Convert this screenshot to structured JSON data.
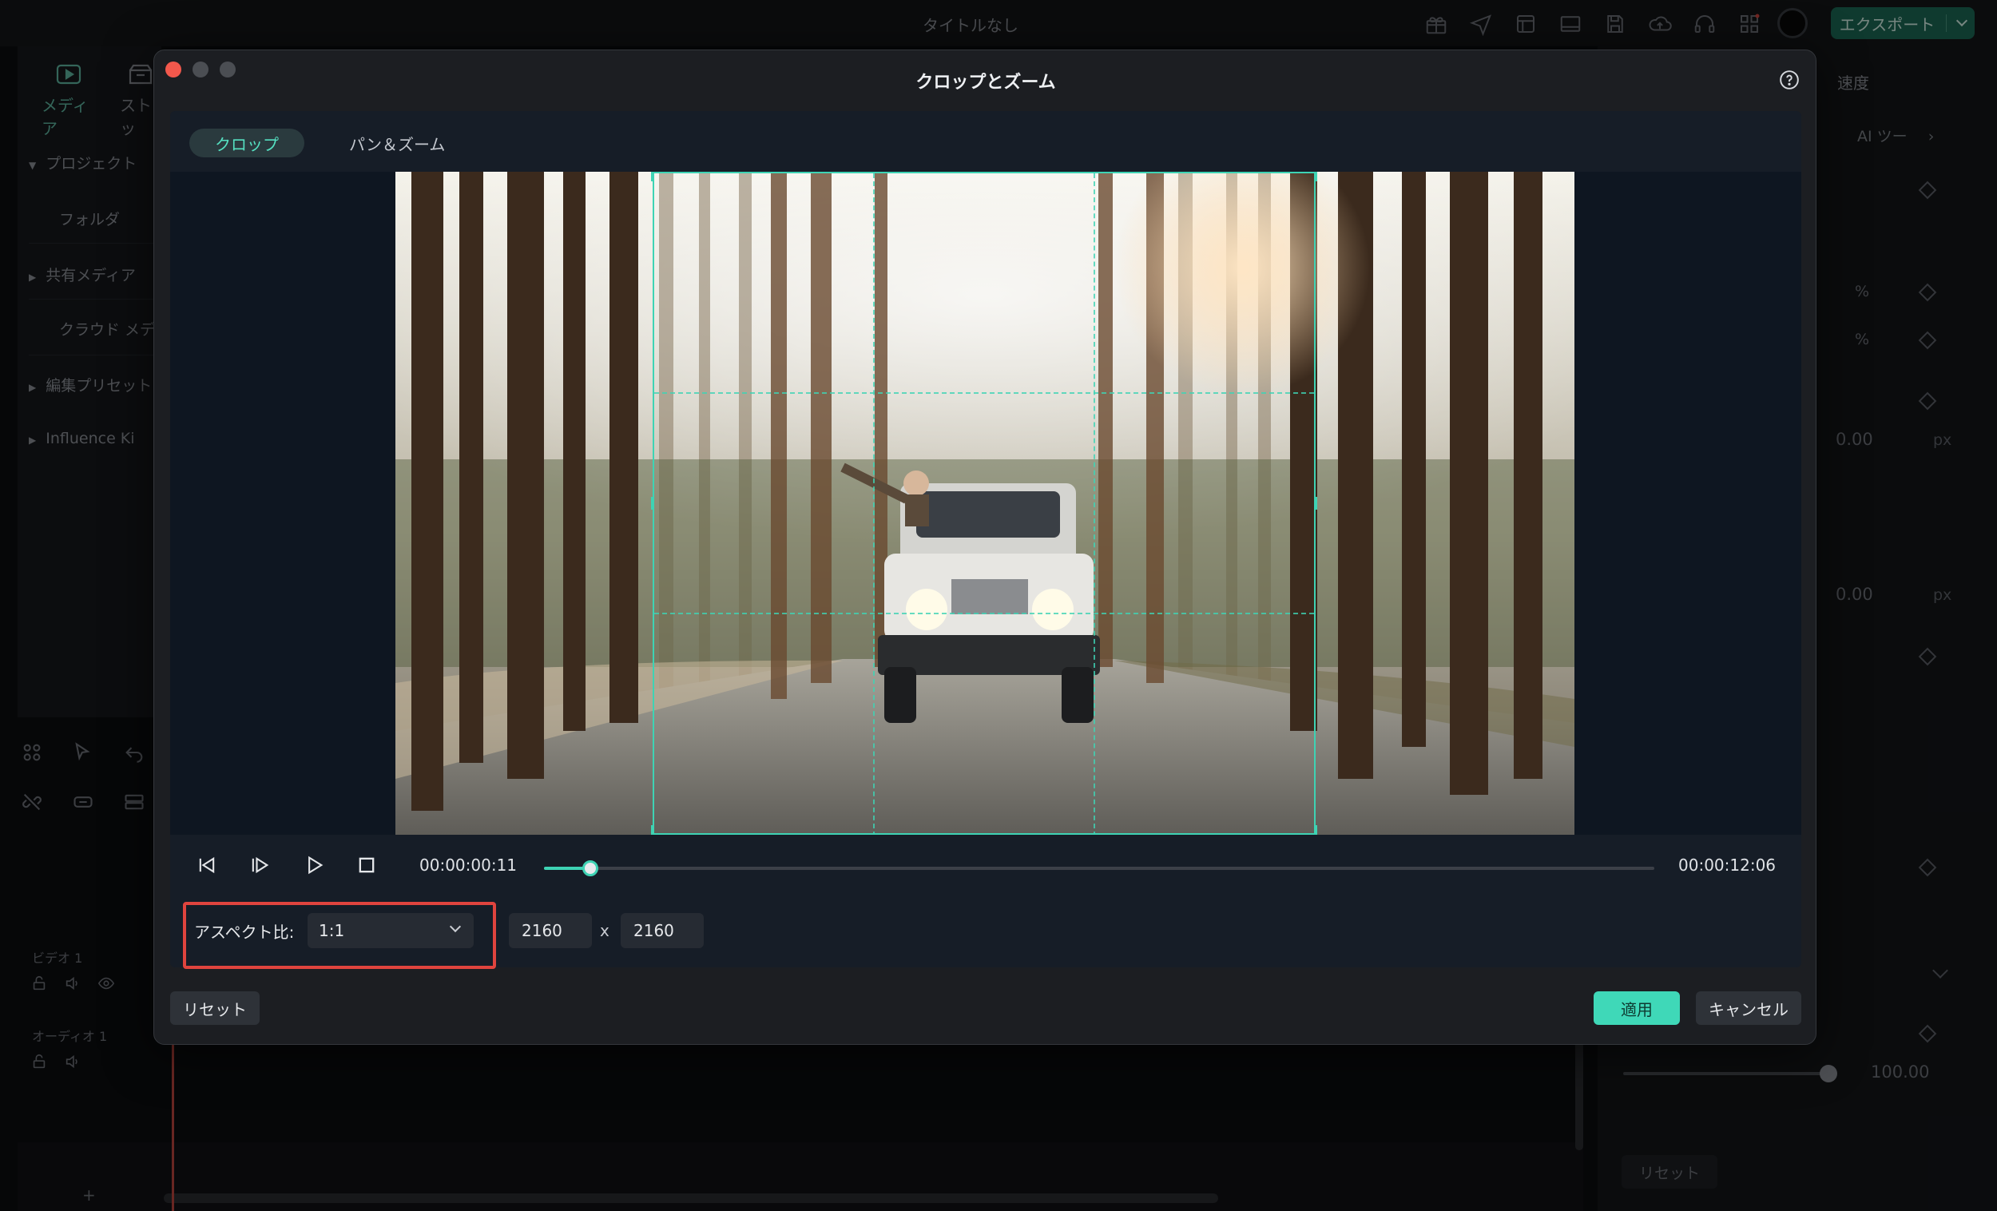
{
  "app": {
    "title": "タイトルなし",
    "export_label": "エクスポート",
    "accent": "#3ed3b4"
  },
  "left_panel": {
    "tabs": [
      {
        "label": "メディア",
        "icon": "media-icon"
      },
      {
        "label": "ストッ",
        "icon": "stock-icon"
      }
    ],
    "items": [
      {
        "label": "プロジェクト"
      },
      {
        "label": "フォルダ"
      },
      {
        "label": "共有メディア"
      },
      {
        "label": "クラウド メデ"
      },
      {
        "label": "編集プリセット"
      },
      {
        "label": "Influence Ki"
      }
    ]
  },
  "timeline": {
    "video_track": "ビデオ 1",
    "audio_track": "オーディオ 1"
  },
  "right_panel": {
    "speed_tab": "速度",
    "ai_tools": "AI ツー",
    "pct_unit": "%",
    "px_unit": "px",
    "value_1": "0.00",
    "value_2": "0.00",
    "slider_value": "100.00",
    "reset_label": "リセット"
  },
  "dialog": {
    "title": "クロップとズーム",
    "tabs": [
      {
        "label": "クロップ",
        "active": true
      },
      {
        "label": "パン＆ズーム",
        "active": false
      }
    ],
    "time_current": "00:00:00:11",
    "time_total": "00:00:12:06",
    "playback_progress": 0.042,
    "aspect_label": "アスペクト比:",
    "aspect_value": "1:1",
    "width_value": "2160",
    "height_value": "2160",
    "x_label": "x",
    "reset_label": "リセット",
    "apply_label": "適用",
    "cancel_label": "キャンセル"
  }
}
